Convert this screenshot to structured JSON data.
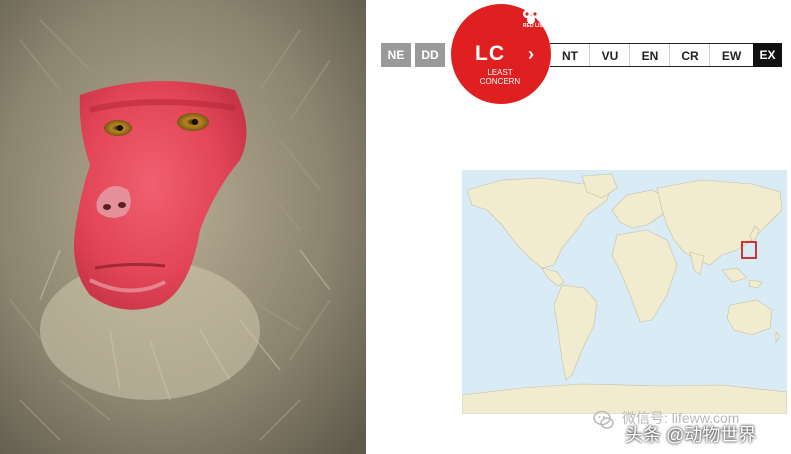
{
  "photo": {
    "subject": "red-faced-monkey-photo"
  },
  "status": {
    "left_categories": [
      "NE",
      "DD"
    ],
    "current": {
      "abbr": "LC",
      "line1": "LEAST",
      "line2": "CONCERN",
      "arrow": "›",
      "badge": "RED LIST"
    },
    "right_categories": [
      "NT",
      "VU",
      "EN",
      "CR",
      "EW",
      "EX"
    ],
    "colors": {
      "current": "#e02020",
      "inactive": "#9a9a9a",
      "extinct": "#111111"
    }
  },
  "map": {
    "highlight_color": "#d21f1f",
    "land_color": "#f1ebcf",
    "ocean_color": "#d9ebf5"
  },
  "watermark": {
    "line1": "微信号: lifeww.com",
    "line2": "头条 @动物世界"
  }
}
